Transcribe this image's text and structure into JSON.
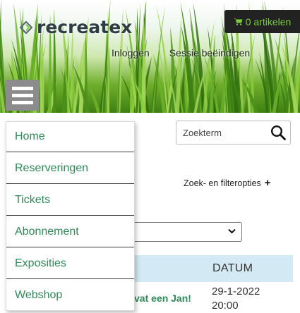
{
  "header": {
    "logo_text": "recreatex",
    "cart_label": "0 artikelen",
    "links": [
      "Inloggen",
      "Sessie beëindigen"
    ]
  },
  "menu": {
    "items": [
      "Home",
      "Reserveringen",
      "Tickets",
      "Abonnement",
      "Exposities",
      "Webshop"
    ]
  },
  "search": {
    "placeholder": "Zoekterm"
  },
  "filter": {
    "label": "Zoek- en filteropties",
    "plus": "+"
  },
  "table": {
    "date_header": "DATUM",
    "rows": [
      {
        "title": "vat een Jan!",
        "date": "29-1-2022",
        "time": "20:00"
      }
    ]
  },
  "colors": {
    "menu_text": "#2e8b57",
    "cart_bg": "#222222",
    "cart_text": "#7ccd3a",
    "table_header_bg": "#d3e9f3",
    "hamburger_bg": "#8c8c8c"
  },
  "icons": [
    "logo-mark-icon",
    "cart-icon",
    "hamburger-icon",
    "search-icon",
    "chevron-down-icon"
  ]
}
